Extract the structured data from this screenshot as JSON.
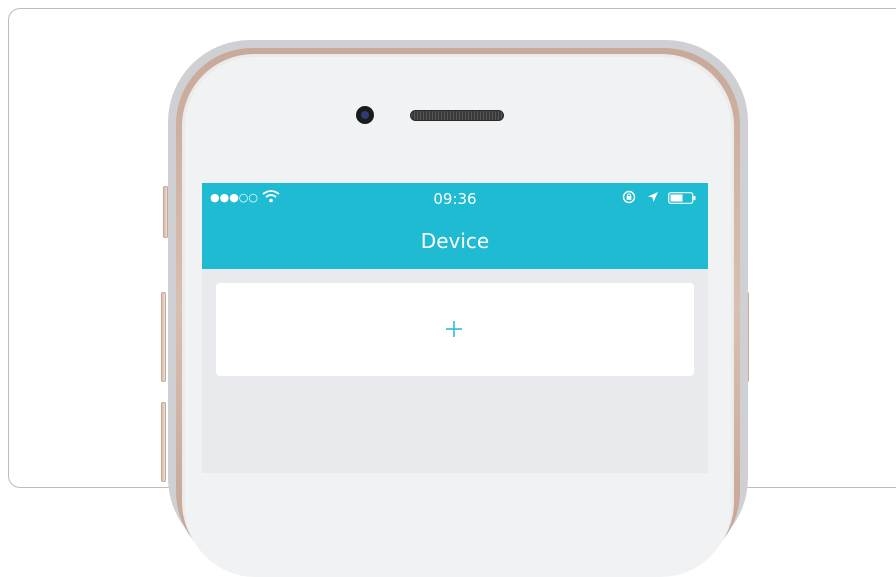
{
  "status_bar": {
    "signal": "●●●○○",
    "time": "09:36",
    "icons": [
      "wifi-icon",
      "rotation-lock-icon",
      "location-icon",
      "battery-icon"
    ]
  },
  "nav": {
    "title": "Device"
  },
  "device_list": {
    "add_icon": "plus-icon"
  },
  "colors": {
    "accent": "#1ebbd2",
    "background": "#e9eaee",
    "card": "#ffffff"
  }
}
